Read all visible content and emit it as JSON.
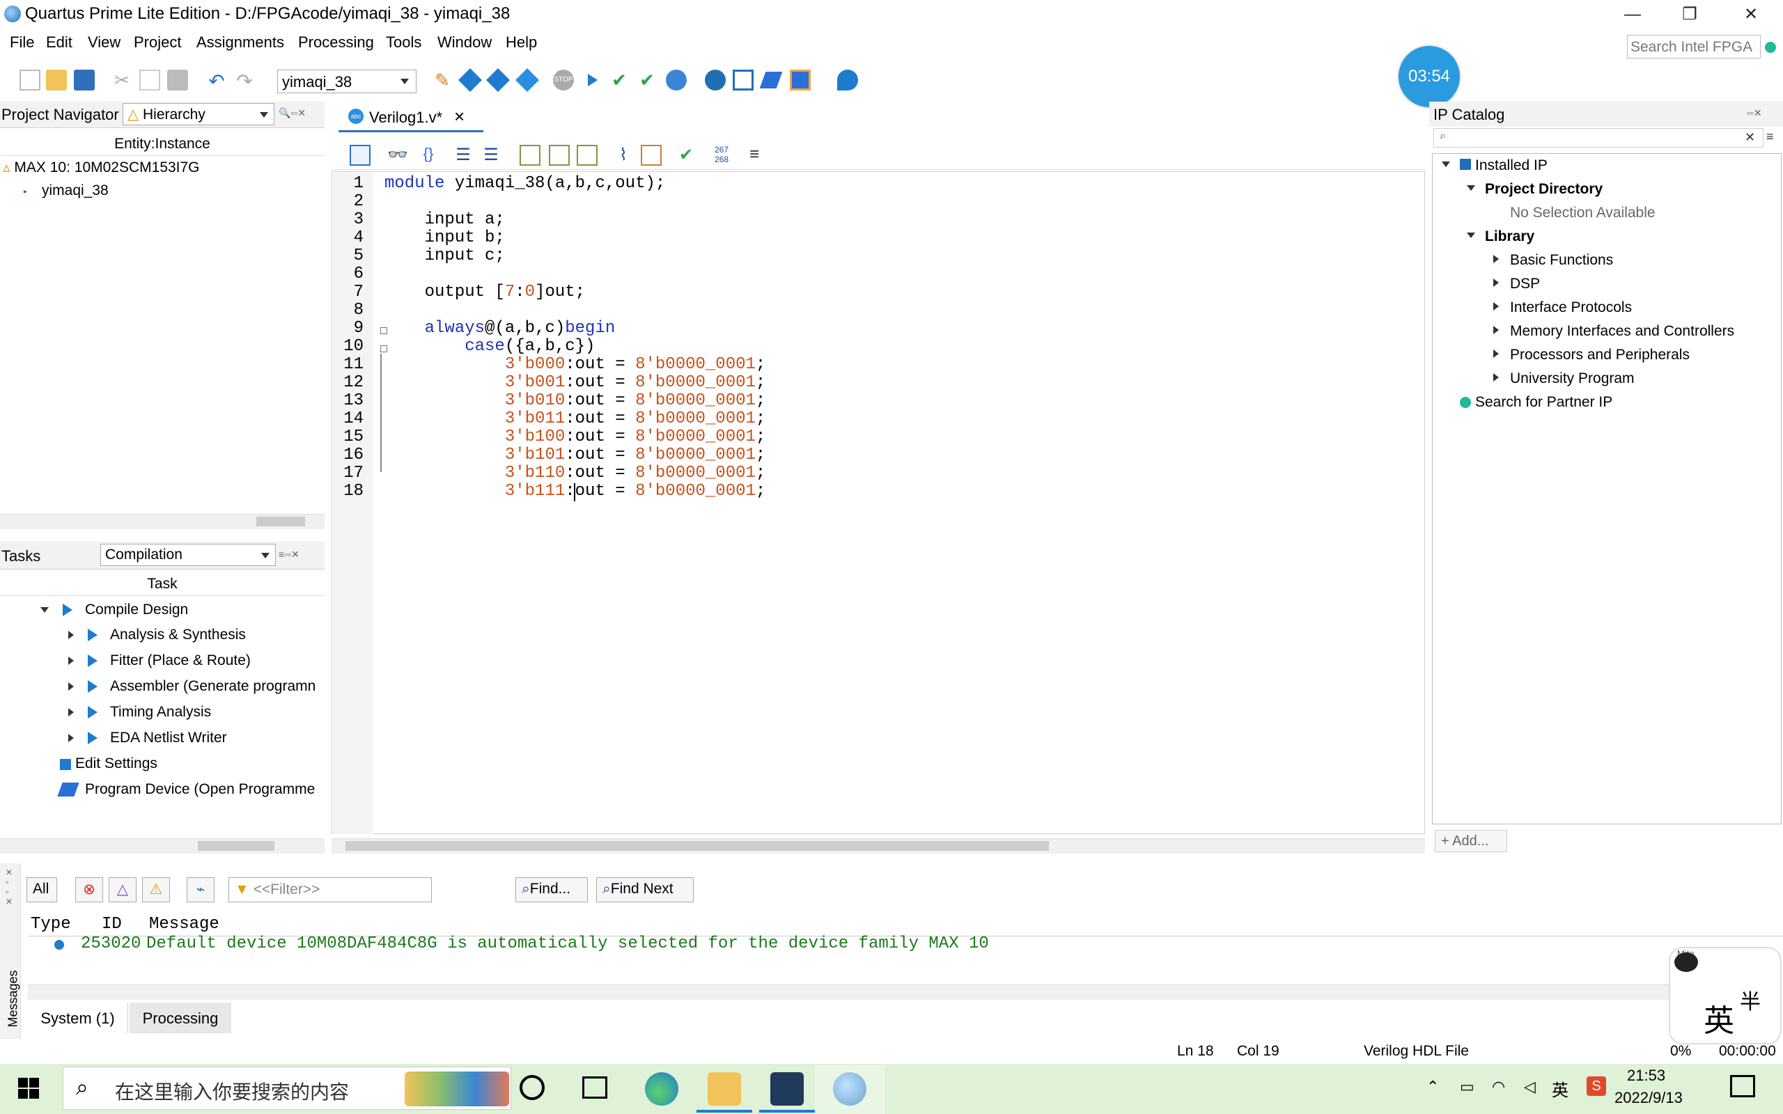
{
  "window": {
    "title": "Quartus Prime Lite Edition - D:/FPGAcode/yimaqi_38 - yimaqi_38",
    "minimize": "—",
    "restore": "❐",
    "close": "✕"
  },
  "menu": [
    "File",
    "Edit",
    "View",
    "Project",
    "Assignments",
    "Processing",
    "Tools",
    "Window",
    "Help"
  ],
  "search": {
    "placeholder": "Search Intel FPGA"
  },
  "toolbar": {
    "revision": "yimaqi_38",
    "timer": "03:54"
  },
  "project_navigator": {
    "title": "Project Navigator",
    "view": "Hierarchy",
    "column": "Entity:Instance",
    "device": "MAX 10: 10M02SCM153I7G",
    "top_entity": "yimaqi_38"
  },
  "tasks": {
    "title": "Tasks",
    "flow": "Compilation",
    "column": "Task",
    "items": [
      "Compile Design",
      "Analysis & Synthesis",
      "Fitter (Place & Route)",
      "Assembler (Generate programn",
      "Timing Analysis",
      "EDA Netlist Writer",
      "Edit Settings",
      "Program Device (Open Programme"
    ]
  },
  "editor": {
    "tab_label": "Verilog1.v*",
    "tab_close": "×",
    "line_numbers": [
      "1",
      "2",
      "3",
      "4",
      "5",
      "6",
      "7",
      "8",
      "9",
      "10",
      "11",
      "12",
      "13",
      "14",
      "15",
      "16",
      "17",
      "18"
    ],
    "lines": [
      "module yimaqi_38(a,b,c,out);",
      "",
      "    input a;",
      "    input b;",
      "    input c;",
      "",
      "    output [7:0]out;",
      "",
      "    always@(a,b,c)begin",
      "        case({a,b,c})",
      "            3'b000:out = 8'b0000_0001;",
      "            3'b001:out = 8'b0000_0001;",
      "            3'b010:out = 8'b0000_0001;",
      "            3'b011:out = 8'b0000_0001;",
      "            3'b100:out = 8'b0000_0001;",
      "            3'b101:out = 8'b0000_0001;",
      "            3'b110:out = 8'b0000_0001;",
      "            3'b111:out = 8'b0000_0001;"
    ],
    "sel_code": [
      "3'b000",
      "3'b001",
      "3'b010",
      "3'b011",
      "3'b100",
      "3'b101",
      "3'b110",
      "3'b111"
    ],
    "rhs": "8'b0000_0001",
    "mid": ":out = ",
    "semi": ";"
  },
  "ip_catalog": {
    "title": "IP Catalog",
    "installed": "Installed IP",
    "project_dir": "Project Directory",
    "no_selection": "No Selection Available",
    "library": "Library",
    "lib_items": [
      "Basic Functions",
      "DSP",
      "Interface Protocols",
      "Memory Interfaces and Controllers",
      "Processors and Peripherals",
      "University Program"
    ],
    "partner": "Search for Partner IP",
    "add": "+ Add..."
  },
  "messages": {
    "all": "All",
    "filter_placeholder": "<<Filter>>",
    "find": "Find...",
    "find_next": "Find Next",
    "columns": [
      "Type",
      "ID",
      "Message"
    ],
    "rows": [
      {
        "id": "253020",
        "text": "Default device 10M08DAF484C8G is automatically selected for the device family MAX 10"
      }
    ],
    "tabs": [
      "System (1)",
      "Processing"
    ],
    "side_label": "Messages"
  },
  "status": {
    "ln": "Ln 18",
    "col": "Col 19",
    "filetype": "Verilog HDL File",
    "progress": "0%",
    "elapsed": "00:00:00"
  },
  "overlay": {
    "char1": "英",
    "char2": "半",
    "brand": "Mite"
  },
  "taskbar": {
    "search_placeholder": "在这里输入你要搜索的内容",
    "ime": "英",
    "time": "21:53",
    "date": "2022/9/13"
  }
}
